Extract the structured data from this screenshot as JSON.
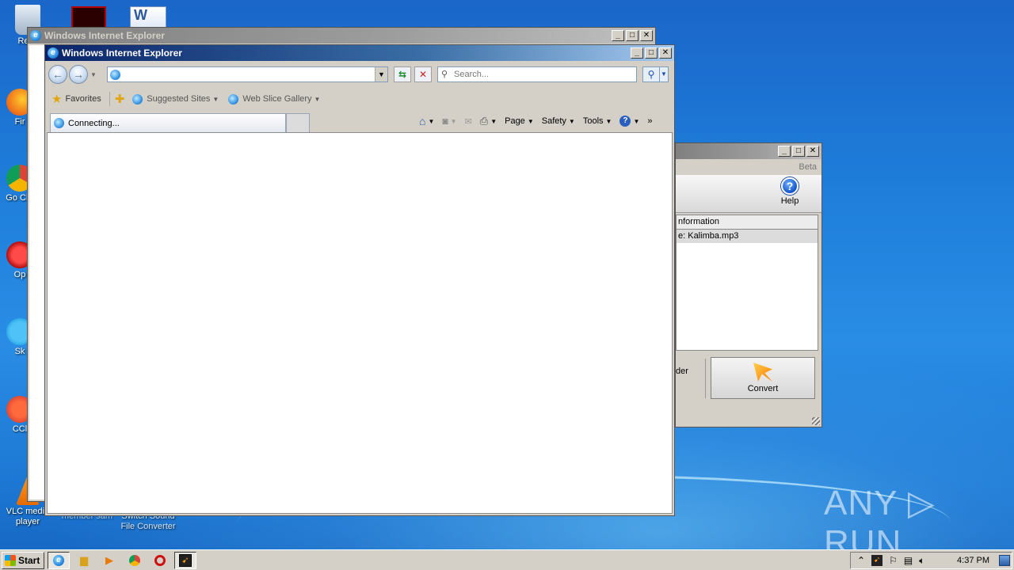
{
  "desktop": {
    "icons": [
      {
        "label": "Recy"
      },
      {
        "label": "Fir"
      },
      {
        "label": "Go Chr"
      },
      {
        "label": "Op"
      },
      {
        "label": "Sk"
      },
      {
        "label": "CCl"
      },
      {
        "label": "VLC media player"
      },
      {
        "label": "member sam"
      },
      {
        "label": "Switch Sound File Converter"
      }
    ],
    "watermark": "ANY ▷ RUN"
  },
  "ie_back_window": {
    "title": "Windows Internet Explorer"
  },
  "ie_front_window": {
    "title": "Windows Internet Explorer",
    "address_value": "",
    "search_placeholder": "Search...",
    "favorites": {
      "favorites_label": "Favorites",
      "suggested_sites": "Suggested Sites",
      "web_slice_gallery": "Web Slice Gallery"
    },
    "tab": {
      "label": "Connecting..."
    },
    "commands": {
      "page": "Page",
      "safety": "Safety",
      "tools": "Tools"
    }
  },
  "converter_window": {
    "beta_label": "Beta",
    "help_label": "Help",
    "list_header": "nformation",
    "list_row": "e: Kalimba.mp3",
    "folder_label_partial": "der",
    "convert_label": "Convert"
  },
  "taskbar": {
    "start_label": "Start",
    "clock": "4:37 PM"
  },
  "colors": {
    "title_active": "#0a246a",
    "title_inactive": "#808080",
    "desktop_blue": "#1f7fdb"
  }
}
